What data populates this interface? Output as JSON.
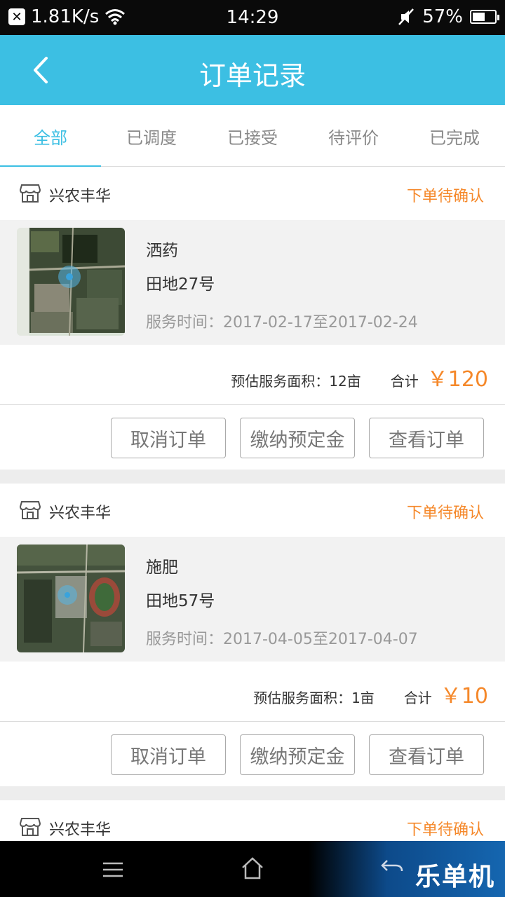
{
  "status_bar": {
    "speed": "1.81K/s",
    "time": "14:29",
    "battery": "57%",
    "battery_level": 0.57
  },
  "header": {
    "title": "订单记录"
  },
  "tabs": [
    {
      "label": "全部",
      "active": true
    },
    {
      "label": "已调度",
      "active": false
    },
    {
      "label": "已接受",
      "active": false
    },
    {
      "label": "待评价",
      "active": false
    },
    {
      "label": "已完成",
      "active": false
    }
  ],
  "orders": [
    {
      "store": "兴农丰华",
      "status": "下单待确认",
      "service": "洒药",
      "field": "田地27号",
      "period": "服务时间：2017-02-17至2017-02-24",
      "area": "预估服务面积：12亩",
      "total_label": "合计",
      "total": "￥120",
      "buttons": [
        "取消订单",
        "缴纳预定金",
        "查看订单"
      ]
    },
    {
      "store": "兴农丰华",
      "status": "下单待确认",
      "service": "施肥",
      "field": "田地57号",
      "period": "服务时间：2017-04-05至2017-04-07",
      "area": "预估服务面积：1亩",
      "total_label": "合计",
      "total": "￥10",
      "buttons": [
        "取消订单",
        "缴纳预定金",
        "查看订单"
      ]
    },
    {
      "store": "兴农丰华",
      "status": "下单待确认"
    }
  ],
  "watermark": "乐单机",
  "colors": {
    "accent": "#3cbfe3",
    "status_orange": "#f5882a"
  }
}
